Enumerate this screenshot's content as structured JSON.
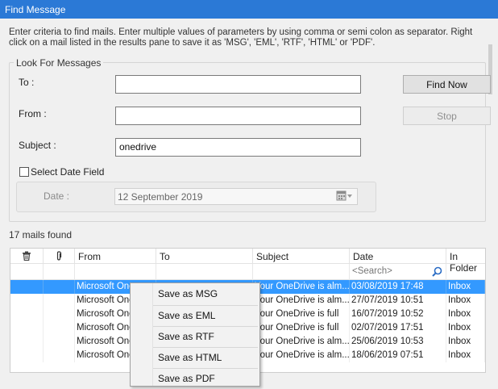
{
  "window": {
    "title": "Find Message"
  },
  "intro_text": "Enter criteria to find mails. Enter multiple values of parameters by using comma or semi colon as separator. Right click on a mail listed in the results pane to save it as 'MSG', 'EML', 'RTF', 'HTML' or 'PDF'.",
  "search": {
    "group_title": "Look For Messages",
    "to_label": "To :",
    "to_value": "",
    "from_label": "From :",
    "from_value": "",
    "subject_label": "Subject :",
    "subject_value": "onedrive",
    "date_checkbox_label": "Select Date Field",
    "date_label": "Date :",
    "date_value": "12 September 2019",
    "find_now_label": "Find Now",
    "stop_label": "Stop"
  },
  "results": {
    "count_label": "17 mails found",
    "columns": {
      "delete_icon": "trash-icon",
      "attachment_icon": "paperclip-icon",
      "from": "From",
      "to": "To",
      "subject": "Subject",
      "date": "Date",
      "folder": "In Folder"
    },
    "date_search_placeholder": "<Search>",
    "rows": [
      {
        "from": "Microsoft One",
        "to": "",
        "subject": "Your OneDrive is alm...",
        "date": "03/08/2019 17:48",
        "folder": "Inbox",
        "selected": true
      },
      {
        "from": "Microsoft One",
        "to": "",
        "subject": "Your OneDrive is alm...",
        "date": "27/07/2019 10:51",
        "folder": "Inbox"
      },
      {
        "from": "Microsoft One",
        "to": "",
        "subject": "Your OneDrive is full",
        "date": "16/07/2019 10:52",
        "folder": "Inbox"
      },
      {
        "from": "Microsoft One",
        "to": "",
        "subject": "Your OneDrive is full",
        "date": "02/07/2019 17:51",
        "folder": "Inbox"
      },
      {
        "from": "Microsoft One",
        "to": "",
        "subject": "Your OneDrive is alm...",
        "date": "25/06/2019 10:53",
        "folder": "Inbox"
      },
      {
        "from": "Microsoft One",
        "to": "",
        "subject": "Your OneDrive is alm...",
        "date": "18/06/2019 07:51",
        "folder": "Inbox"
      }
    ]
  },
  "context_menu": {
    "items": [
      "Save as MSG",
      "Save as EML",
      "Save as RTF",
      "Save as HTML",
      "Save as PDF"
    ]
  },
  "colors": {
    "title_bar": "#2b79d6",
    "selection": "#3399ff"
  }
}
